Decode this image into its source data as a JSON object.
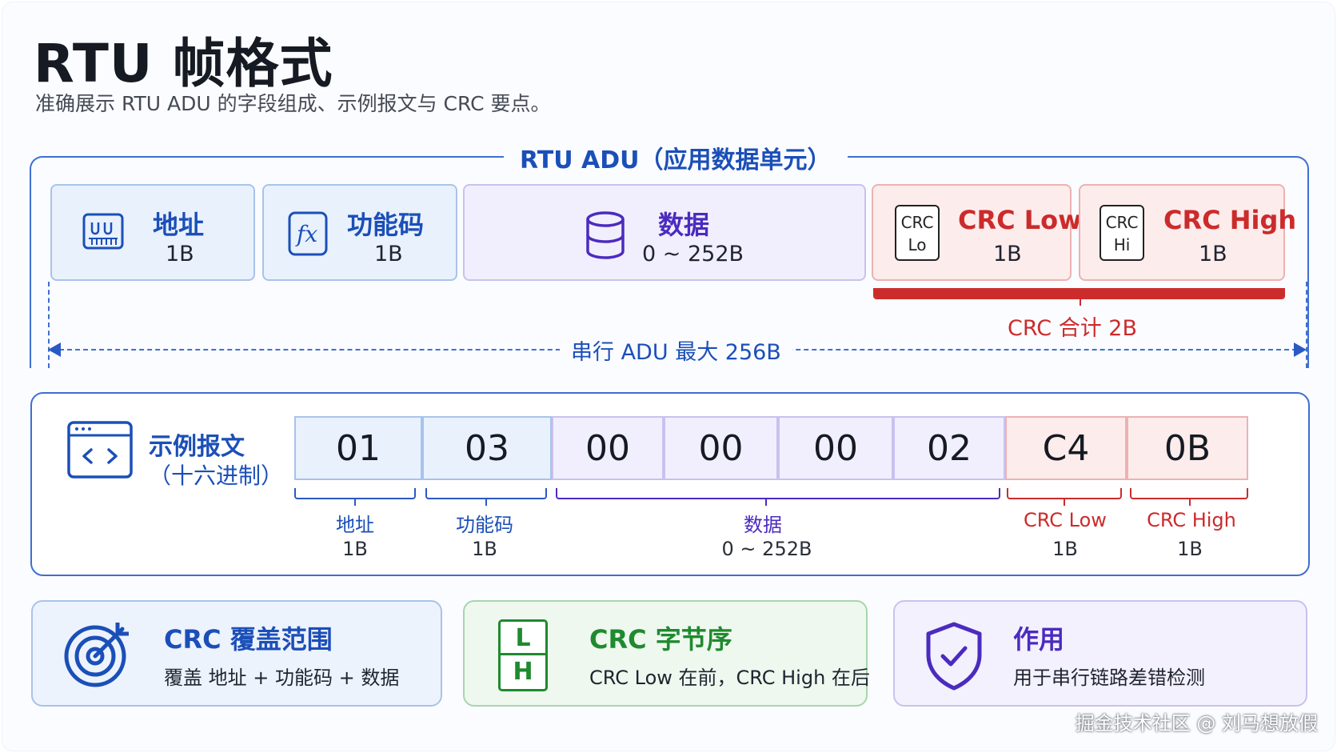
{
  "title": "RTU 帧格式",
  "subtitle": "准确展示 RTU ADU 的字段组成、示例报文与 CRC 要点。",
  "adu": {
    "legend": "RTU ADU（应用数据单元）",
    "fields": [
      {
        "name": "地址",
        "size": "1B",
        "icon": "address-register-icon"
      },
      {
        "name": "功能码",
        "size": "1B",
        "icon": "function-fx-icon"
      },
      {
        "name": "数据",
        "size": "0 ~ 252B",
        "icon": "database-icon"
      },
      {
        "name": "CRC Low",
        "size": "1B",
        "icon": "crc-lo-icon",
        "badge_top": "CRC",
        "badge_bottom": "Lo"
      },
      {
        "name": "CRC High",
        "size": "1B",
        "icon": "crc-hi-icon",
        "badge_top": "CRC",
        "badge_bottom": "Hi"
      }
    ],
    "crc_total": "CRC 合计 2B",
    "max_label": "串行 ADU 最大 256B"
  },
  "example": {
    "title": "示例报文",
    "subtitle": "（十六进制）",
    "icon": "code-window-icon",
    "bytes": [
      "01",
      "03",
      "00",
      "00",
      "00",
      "02",
      "C4",
      "0B"
    ],
    "groups": [
      {
        "name": "地址",
        "size": "1B"
      },
      {
        "name": "功能码",
        "size": "1B"
      },
      {
        "name": "数据",
        "size": "0 ~ 252B"
      },
      {
        "name": "CRC Low",
        "size": "1B"
      },
      {
        "name": "CRC High",
        "size": "1B"
      }
    ]
  },
  "cards": [
    {
      "title": "CRC 覆盖范围",
      "text": "覆盖 地址 + 功能码 + 数据",
      "icon": "target-icon"
    },
    {
      "title": "CRC 字节序",
      "text": "CRC Low 在前，CRC High 在后",
      "icon": "byte-order-lh-icon",
      "badge_top": "L",
      "badge_bottom": "H"
    },
    {
      "title": "作用",
      "text": "用于串行链路差错检测",
      "icon": "shield-check-icon"
    }
  ],
  "colors": {
    "blue": "#1b4fb8",
    "purple": "#4b2bbf",
    "red": "#cc2b2b",
    "green": "#1f8a2e"
  },
  "watermark": "掘金技术社区 @ 刘马想放假"
}
